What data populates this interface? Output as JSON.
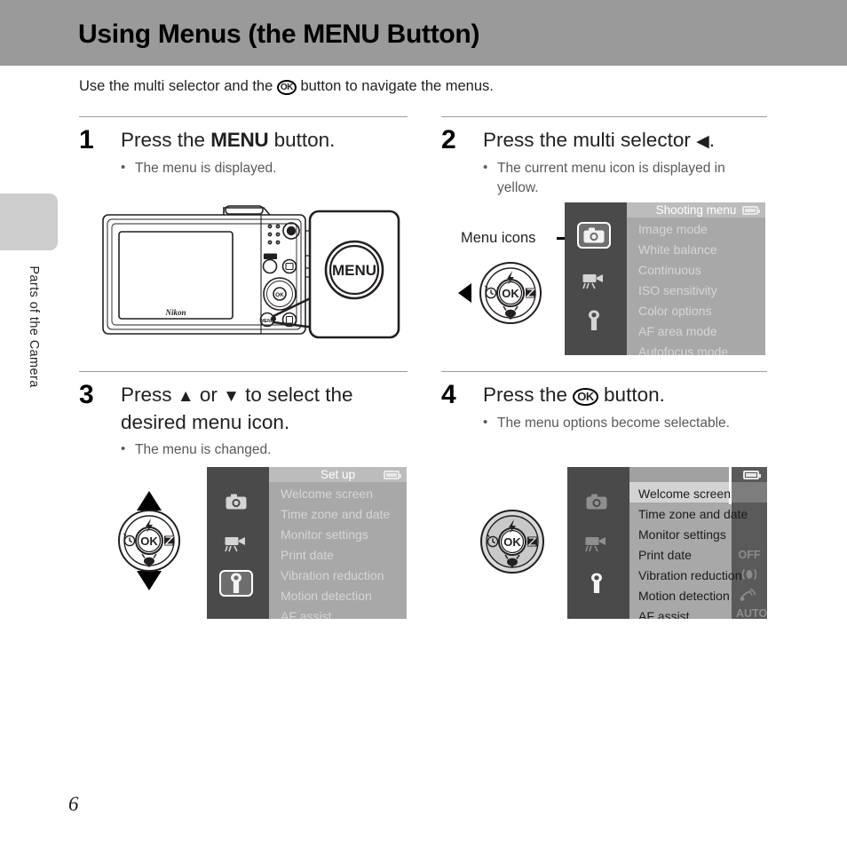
{
  "header": {
    "title_before": "Using Menus (the ",
    "title_menu": "MENU",
    "title_after": " Button)",
    "band_color": "#9a9a9a"
  },
  "intro": {
    "text_before": "Use the multi selector and the ",
    "ok_label": "OK",
    "text_after": " button to navigate the menus."
  },
  "sidebar": {
    "tab_label": "Parts of the Camera",
    "tab_color": "#cdcdcd"
  },
  "page_number": "6",
  "steps": [
    {
      "number": "1",
      "heading_before": "Press the ",
      "heading_menu": "MENU",
      "heading_after": " button.",
      "bullets": [
        "The menu is displayed."
      ]
    },
    {
      "number": "2",
      "heading_before": "Press the multi selector ",
      "heading_arrow": "◀",
      "heading_after": ".",
      "bullets": [
        "The current menu icon is displayed in yellow."
      ]
    },
    {
      "number": "3",
      "heading_before": "Press ",
      "heading_arrow_up": "▲",
      "heading_mid": " or ",
      "heading_arrow_down": "▼",
      "heading_after": " to select the desired menu icon.",
      "bullets": [
        "The menu is changed."
      ]
    },
    {
      "number": "4",
      "heading_before": "Press the ",
      "ok_label": "OK",
      "heading_after": " button.",
      "bullets": [
        "The menu options become selectable."
      ]
    }
  ],
  "callout": {
    "menu_icons_label": "Menu icons"
  },
  "camera_illustration": {
    "brand": "Nikon",
    "menu_button_label": "MENU"
  },
  "screens": {
    "shooting_menu": {
      "title": "Shooting menu",
      "items": [
        "Image mode",
        "White balance",
        "Continuous",
        "ISO sensitivity",
        "Color options",
        "AF area mode",
        "Autofocus mode"
      ],
      "selected_tab": "shooting",
      "state": "dimmed",
      "battery_icon": "battery-icon"
    },
    "setup_menu_dimmed": {
      "title": "Set up",
      "items": [
        "Welcome screen",
        "Time zone and date",
        "Monitor settings",
        "Print date",
        "Vibration reduction",
        "Motion detection",
        "AF assist"
      ],
      "selected_tab": "setup",
      "state": "dimmed",
      "battery_icon": "battery-icon"
    },
    "setup_menu_active": {
      "title": "",
      "items": [
        "Welcome screen",
        "Time zone and date",
        "Monitor settings",
        "Print date",
        "Vibration reduction",
        "Motion detection",
        "AF assist"
      ],
      "values": [
        "",
        "",
        "",
        "OFF",
        "vr-icon",
        "motion-detection-icon",
        "AUTO"
      ],
      "highlighted_item": "Welcome screen",
      "selected_tab": "setup",
      "state": "active",
      "battery_icon": "battery-icon"
    }
  },
  "tabs": {
    "shooting": "camera-icon",
    "movie": "movie-camera-icon",
    "setup": "wrench-icon"
  },
  "dial": {
    "ok_label": "OK",
    "top_icon": "flash-icon",
    "left_icon": "self-timer-icon",
    "right_icon": "exposure-compensation-icon",
    "bottom_icon": "macro-icon"
  },
  "colors": {
    "screen_bg": "#4a4a4a",
    "list_bg_dimmed": "#a8a8a8",
    "list_bg_active": "#a8a8a8",
    "title_bar": "#bcbcbc",
    "value_col": "#5a5a5a",
    "highlight_row": "#d3d3d3",
    "text_dim": "#d6d6d6",
    "text_active": "#1c1c1c"
  }
}
